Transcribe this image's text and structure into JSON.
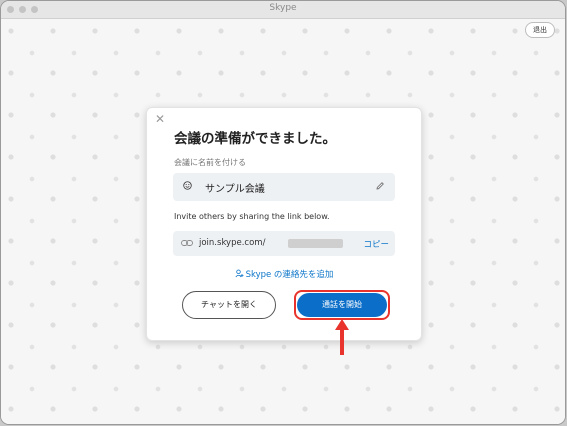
{
  "window": {
    "title": "Skype",
    "exit_label": "退出"
  },
  "dialog": {
    "title": "会議の準備ができました。",
    "name_label": "会議に名前を付ける",
    "name_value": "サンプル会議",
    "invite_text": "Invite others by sharing the link below.",
    "link_text": "join.skype.com/",
    "copy_label": "コピー",
    "add_contacts_label": "Skype の連絡先を追加",
    "chat_button": "チャットを開く",
    "start_button": "通話を開始"
  },
  "colors": {
    "accent": "#0b6fc9",
    "link": "#0b75c9",
    "highlight": "#e8342c"
  },
  "icons": [
    "close-icon",
    "smile-icon",
    "pencil-icon",
    "link-icon",
    "add-contact-icon",
    "arrow-up-icon"
  ]
}
